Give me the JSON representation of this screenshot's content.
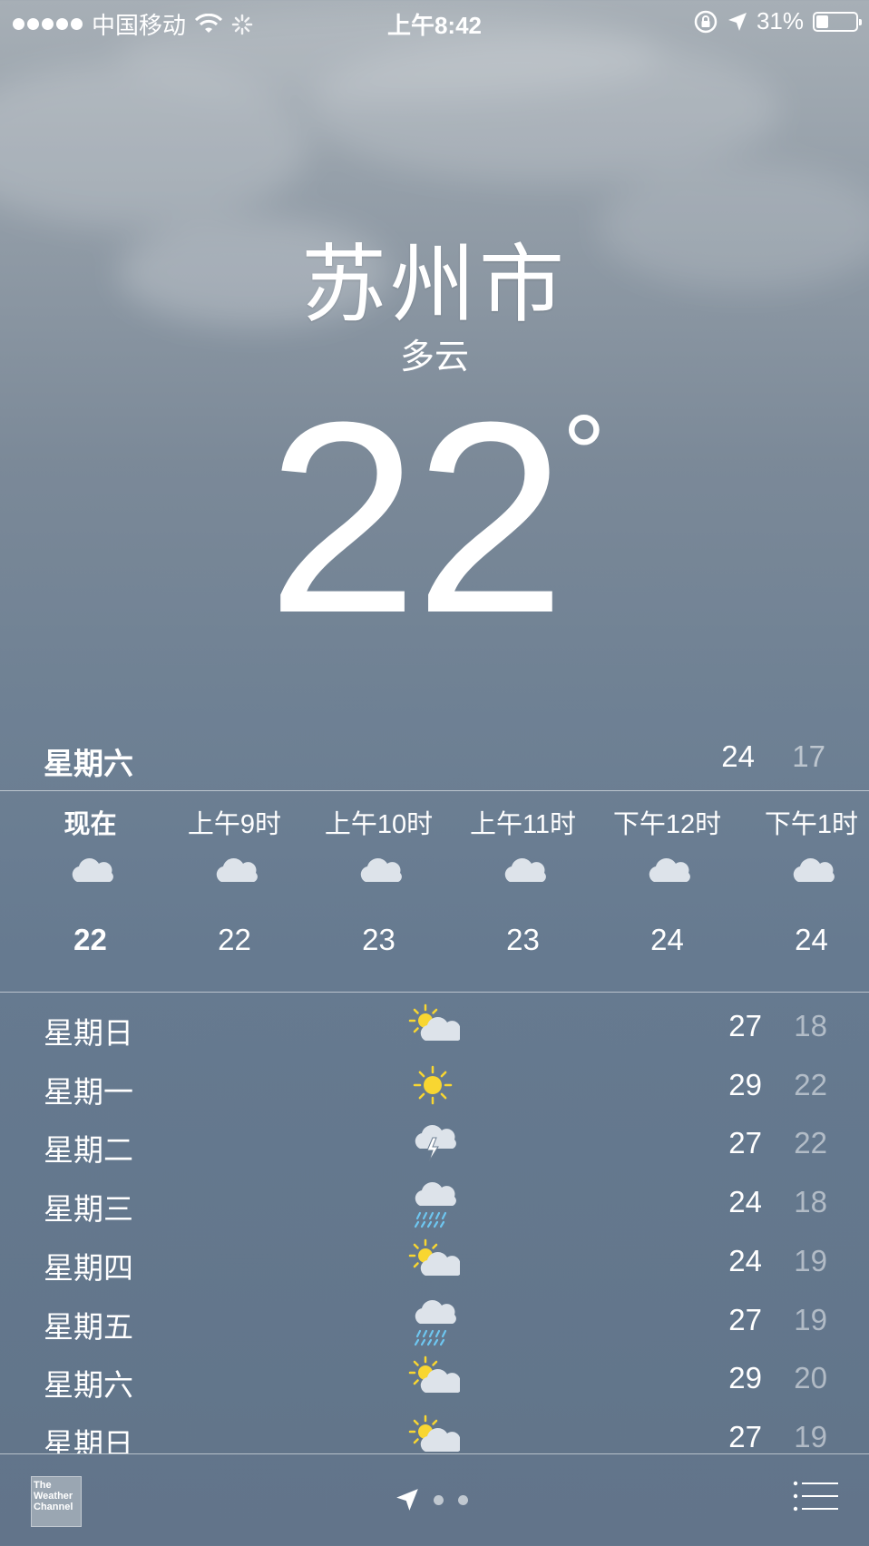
{
  "status_bar": {
    "carrier": "中国移动",
    "time": "上午8:42",
    "battery_percent": "31%",
    "battery_level": 0.31
  },
  "location": {
    "city": "苏州市",
    "condition": "多云",
    "temperature": "22",
    "degree_symbol": "°"
  },
  "today": {
    "day": "星期六",
    "high": "24",
    "low": "17"
  },
  "hourly": [
    {
      "time": "现在",
      "icon": "cloud-icon",
      "temp": "22"
    },
    {
      "time": "上午9时",
      "icon": "cloud-icon",
      "temp": "22"
    },
    {
      "time": "上午10时",
      "icon": "cloud-icon",
      "temp": "23"
    },
    {
      "time": "上午11时",
      "icon": "cloud-icon",
      "temp": "23"
    },
    {
      "time": "下午12时",
      "icon": "cloud-icon",
      "temp": "24"
    },
    {
      "time": "下午1时",
      "icon": "cloud-icon",
      "temp": "24"
    }
  ],
  "daily": [
    {
      "day": "星期日",
      "icon": "partly-sunny-icon",
      "high": "27",
      "low": "18"
    },
    {
      "day": "星期一",
      "icon": "sun-icon",
      "high": "29",
      "low": "22"
    },
    {
      "day": "星期二",
      "icon": "thunderstorm-icon",
      "high": "27",
      "low": "22"
    },
    {
      "day": "星期三",
      "icon": "rain-icon",
      "high": "24",
      "low": "18"
    },
    {
      "day": "星期四",
      "icon": "partly-sunny-icon",
      "high": "24",
      "low": "19"
    },
    {
      "day": "星期五",
      "icon": "rain-icon",
      "high": "27",
      "low": "19"
    },
    {
      "day": "星期六",
      "icon": "partly-sunny-icon",
      "high": "29",
      "low": "20"
    },
    {
      "day": "星期日",
      "icon": "partly-sunny-icon",
      "high": "27",
      "low": "19"
    }
  ],
  "bottom_bar": {
    "logo_text": "The Weather Channel",
    "page_count": 3,
    "current_page": 1
  },
  "colors": {
    "sun": "#f8d631",
    "cloud": "#dde3ea",
    "rain": "#6ec6f0",
    "low_temp_text": "rgba(255,255,255,0.5)"
  }
}
